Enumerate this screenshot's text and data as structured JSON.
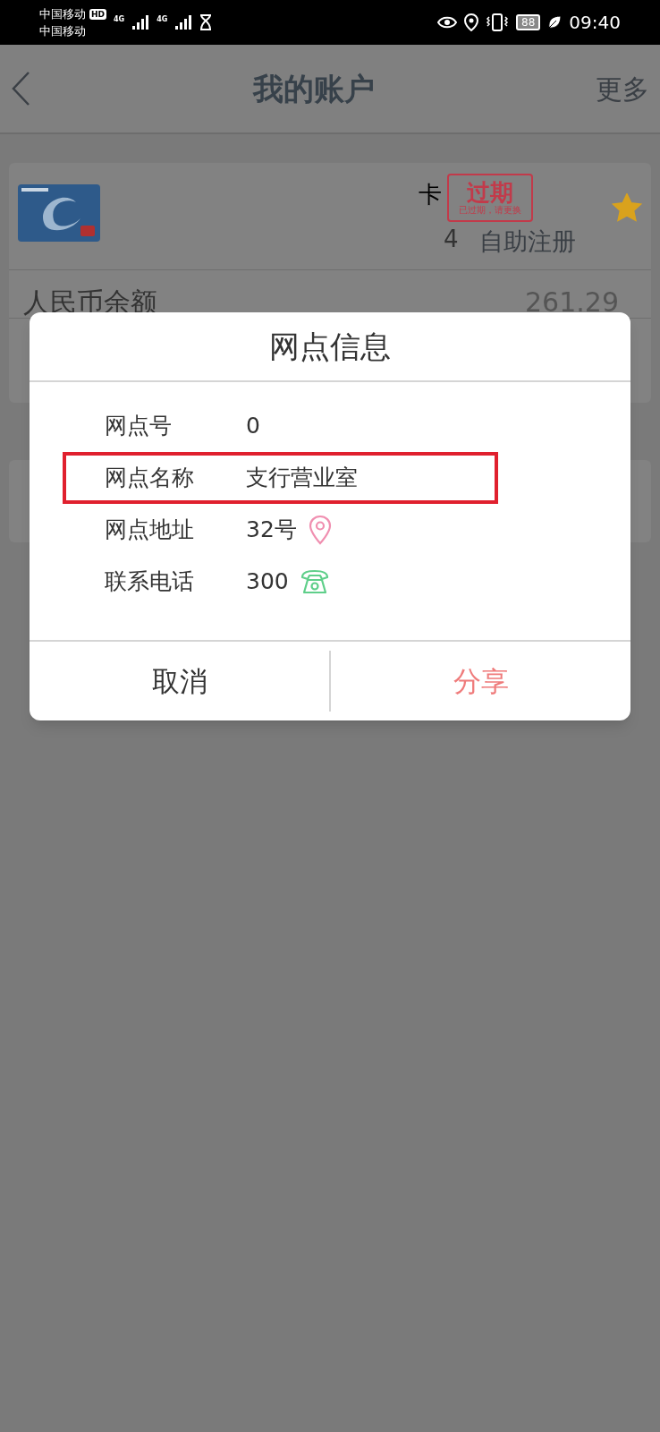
{
  "status_bar": {
    "carrier_1": "中国移动",
    "hd_badge": "HD",
    "carrier_2": "中国移动",
    "network_1": "4G",
    "network_2": "4G",
    "battery": "88",
    "time": "09:40"
  },
  "header": {
    "title": "我的账户",
    "more": "更多"
  },
  "account_card": {
    "card_label": "卡",
    "stamp": "过期",
    "stamp_note": "已过期，请更换",
    "card_digit": "4",
    "self_register": "自助注册",
    "starred": true,
    "balance_label": "人民币余额",
    "balance": "261.29"
  },
  "dialog": {
    "title": "网点信息",
    "fields": [
      {
        "label": "网点号",
        "value": "0",
        "kind": "text",
        "highlighted": false
      },
      {
        "label": "网点名称",
        "value": "支行营业室",
        "kind": "text",
        "highlighted": true
      },
      {
        "label": "网点地址",
        "value": "32号",
        "kind": "address",
        "highlighted": false
      },
      {
        "label": "联系电话",
        "value": "300",
        "kind": "phone",
        "highlighted": false
      }
    ],
    "buttons": [
      {
        "label": "取消",
        "kind": "cancel"
      },
      {
        "label": "分享",
        "kind": "primary"
      }
    ]
  }
}
